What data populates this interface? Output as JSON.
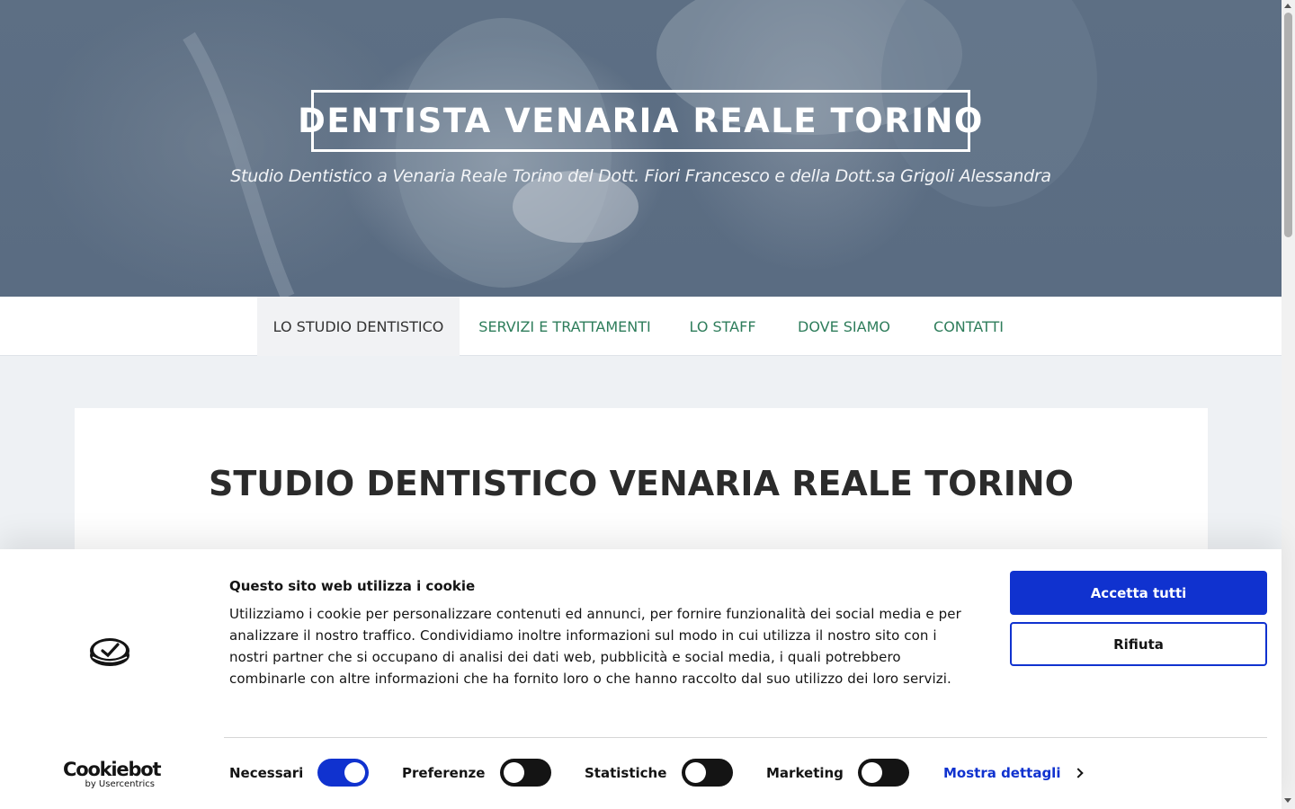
{
  "hero": {
    "title": "DENTISTA VENARIA REALE TORINO",
    "subtitle": "Studio Dentistico a Venaria Reale Torino del Dott. Fiori Francesco e della Dott.sa Grigoli Alessandra"
  },
  "nav": {
    "items": [
      {
        "label": "LO STUDIO DENTISTICO",
        "active": true
      },
      {
        "label": "SERVIZI E TRATTAMENTI",
        "active": false
      },
      {
        "label": "LO STAFF",
        "active": false
      },
      {
        "label": "DOVE SIAMO",
        "active": false
      },
      {
        "label": "CONTATTI",
        "active": false
      }
    ]
  },
  "main": {
    "heading": "STUDIO DENTISTICO VENARIA REALE TORINO"
  },
  "cookie_banner": {
    "title": "Questo sito web utilizza i cookie",
    "body": "Utilizziamo i cookie per personalizzare contenuti ed annunci, per fornire funzionalità dei social media e per analizzare il nostro traffico. Condividiamo inoltre informazioni sul modo in cui utilizza il nostro sito con i nostri partner che si occupano di analisi dei dati web, pubblicità e social media, i quali potrebbero combinarle con altre informazioni che ha fornito loro o che hanno raccolto dal suo utilizzo dei loro servizi.",
    "accept_label": "Accetta tutti",
    "reject_label": "Rifiuta",
    "brand_main": "Cookiebot",
    "brand_sub": "by Usercentrics",
    "toggles": [
      {
        "label": "Necessari",
        "checked": true
      },
      {
        "label": "Preferenze",
        "checked": false
      },
      {
        "label": "Statistiche",
        "checked": false
      },
      {
        "label": "Marketing",
        "checked": false
      }
    ],
    "details_label": "Mostra dettagli"
  },
  "colors": {
    "accent_blue": "#1032cf",
    "nav_link_green": "#2e7d5b",
    "hero_overlay": "#5d6f84"
  },
  "icons": {
    "cookiebot_logo": "cookiebot-logo-icon",
    "details_chevron": "chevron-right-icon"
  }
}
